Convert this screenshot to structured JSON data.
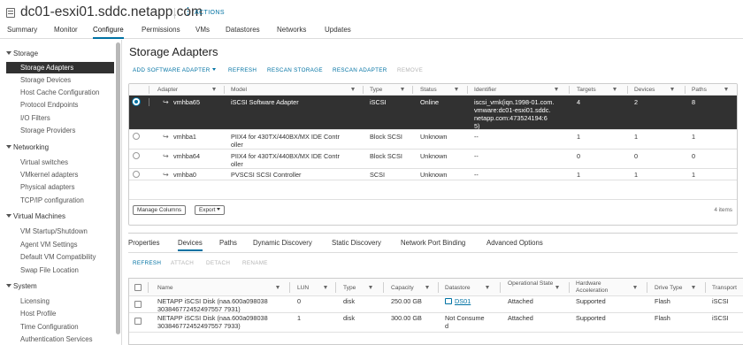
{
  "header": {
    "title": "dc01-esxi01.sddc.netapp.com",
    "actions_label": "ACTIONS",
    "tabs": [
      "Summary",
      "Monitor",
      "Configure",
      "Permissions",
      "VMs",
      "Datastores",
      "Networks",
      "Updates"
    ],
    "active_tab": "Configure"
  },
  "nav": {
    "groups": [
      {
        "label": "Storage",
        "items": [
          "Storage Adapters",
          "Storage Devices",
          "Host Cache Configuration",
          "Protocol Endpoints",
          "I/O Filters",
          "Storage Providers"
        ]
      },
      {
        "label": "Networking",
        "items": [
          "Virtual switches",
          "VMkernel adapters",
          "Physical adapters",
          "TCP/IP configuration"
        ]
      },
      {
        "label": "Virtual Machines",
        "items": [
          "VM Startup/Shutdown",
          "Agent VM Settings",
          "Default VM Compatibility",
          "Swap File Location"
        ]
      },
      {
        "label": "System",
        "items": [
          "Licensing",
          "Host Profile",
          "Time Configuration",
          "Authentication Services"
        ]
      }
    ],
    "active_item": "Storage Adapters"
  },
  "page": {
    "title": "Storage Adapters",
    "toolbar": {
      "add": "ADD SOFTWARE ADAPTER",
      "refresh": "REFRESH",
      "rescan_storage": "RESCAN STORAGE",
      "rescan_adapter": "RESCAN ADAPTER",
      "remove": "REMOVE"
    }
  },
  "adapters": {
    "columns": [
      "Adapter",
      "Model",
      "Type",
      "Status",
      "Identifier",
      "Targets",
      "Devices",
      "Paths"
    ],
    "rows": [
      {
        "adapter": "vmhba65",
        "model": [
          "iSCSI Software Adapter"
        ],
        "type": "iSCSI",
        "status": "Online",
        "identifier": [
          "iscsi_vmk(iqn.1998-01.com.",
          "vmware:dc01-esxi01.sddc.",
          "netapp.com:473524194:6",
          "5)"
        ],
        "targets": "4",
        "devices": "2",
        "paths": "8",
        "selected": true
      },
      {
        "adapter": "vmhba1",
        "model": [
          "PIIX4 for 430TX/440BX/MX IDE Contr",
          "oller"
        ],
        "type": "Block SCSI",
        "status": "Unknown",
        "identifier": [
          "--"
        ],
        "targets": "1",
        "devices": "1",
        "paths": "1",
        "selected": false
      },
      {
        "adapter": "vmhba64",
        "model": [
          "PIIX4 for 430TX/440BX/MX IDE Contr",
          "oller"
        ],
        "type": "Block SCSI",
        "status": "Unknown",
        "identifier": [
          "--"
        ],
        "targets": "0",
        "devices": "0",
        "paths": "0",
        "selected": false
      },
      {
        "adapter": "vmhba0",
        "model": [
          "PVSCSI SCSI Controller"
        ],
        "type": "SCSI",
        "status": "Unknown",
        "identifier": [
          "--"
        ],
        "targets": "1",
        "devices": "1",
        "paths": "1",
        "selected": false
      }
    ],
    "manage_columns": "Manage Columns",
    "export": "Export",
    "items_count": "4 items"
  },
  "details": {
    "tabs": [
      "Properties",
      "Devices",
      "Paths",
      "Dynamic Discovery",
      "Static Discovery",
      "Network Port Binding",
      "Advanced Options"
    ],
    "active_tab": "Devices",
    "toolbar": {
      "refresh": "REFRESH",
      "attach": "ATTACH",
      "detach": "DETACH",
      "rename": "RENAME"
    },
    "columns": [
      "Name",
      "LUN",
      "Type",
      "Capacity",
      "Datastore",
      "Operational State",
      "Hardware Acceleration",
      "Drive Type",
      "Transport"
    ],
    "rows": [
      {
        "name": [
          "NETAPP iSCSI Disk (naa.600a098038",
          "303846772452497557 7931)"
        ],
        "lun": "0",
        "type": "disk",
        "capacity": "250.00 GB",
        "datastore": [
          "DS01"
        ],
        "state": "Attached",
        "hw": "Supported",
        "drive": "Flash",
        "transport": "iSCSI"
      },
      {
        "name": [
          "NETAPP iSCSI Disk (naa.600a098038",
          "303846772452497557 7933)"
        ],
        "lun": "1",
        "type": "disk",
        "capacity": "300.00 GB",
        "datastore": [
          "Not Consume",
          "d"
        ],
        "state": "Attached",
        "hw": "Supported",
        "drive": "Flash",
        "transport": "iSCSI"
      }
    ]
  },
  "colors": {
    "accent": "#0072a3",
    "selected_row": "#313131"
  }
}
